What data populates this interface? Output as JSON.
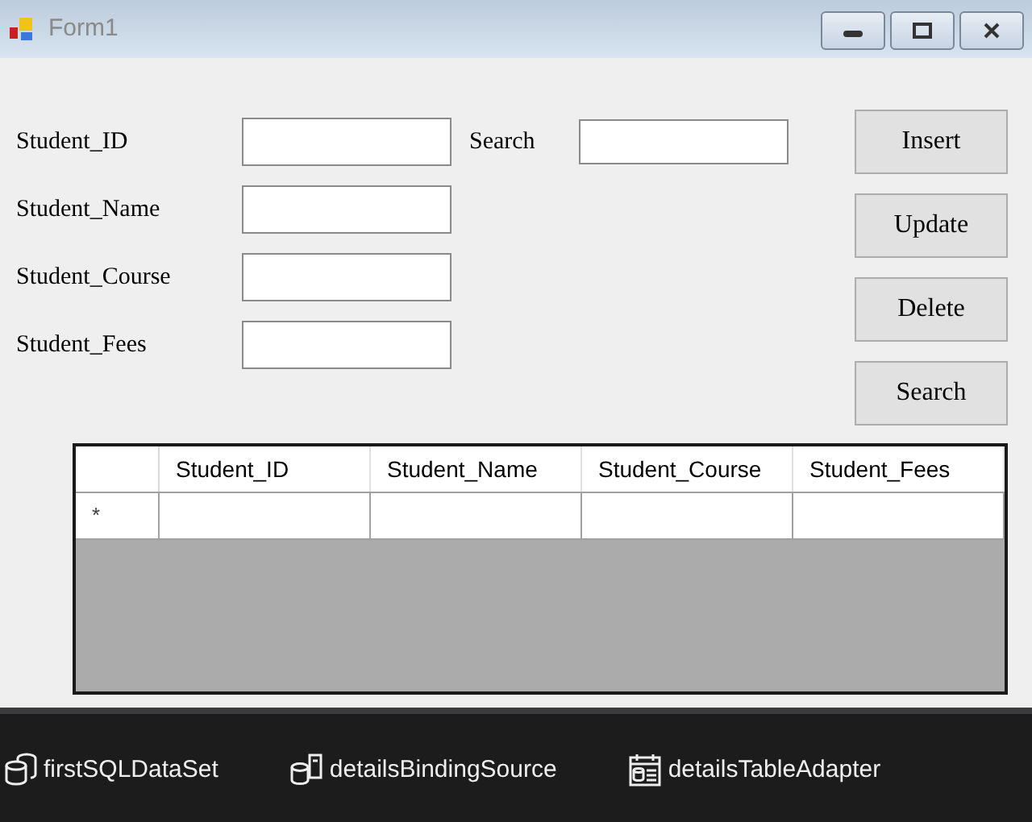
{
  "window": {
    "title": "Form1"
  },
  "fields": [
    {
      "label": "Student_ID"
    },
    {
      "label": "Student_Name"
    },
    {
      "label": "Student_Course"
    },
    {
      "label": "Student_Fees"
    }
  ],
  "search": {
    "label": "Search"
  },
  "buttons": [
    "Insert",
    "Update",
    "Delete",
    "Search"
  ],
  "grid": {
    "columns": [
      "Student_ID",
      "Student_Name",
      "Student_Course",
      "Student_Fees"
    ],
    "new_row_marker": "*"
  },
  "tray": [
    {
      "label": "firstSQLDataSet",
      "kind": "dataset"
    },
    {
      "label": "detailsBindingSource",
      "kind": "binding"
    },
    {
      "label": "detailsTableAdapter",
      "kind": "adapter"
    }
  ]
}
